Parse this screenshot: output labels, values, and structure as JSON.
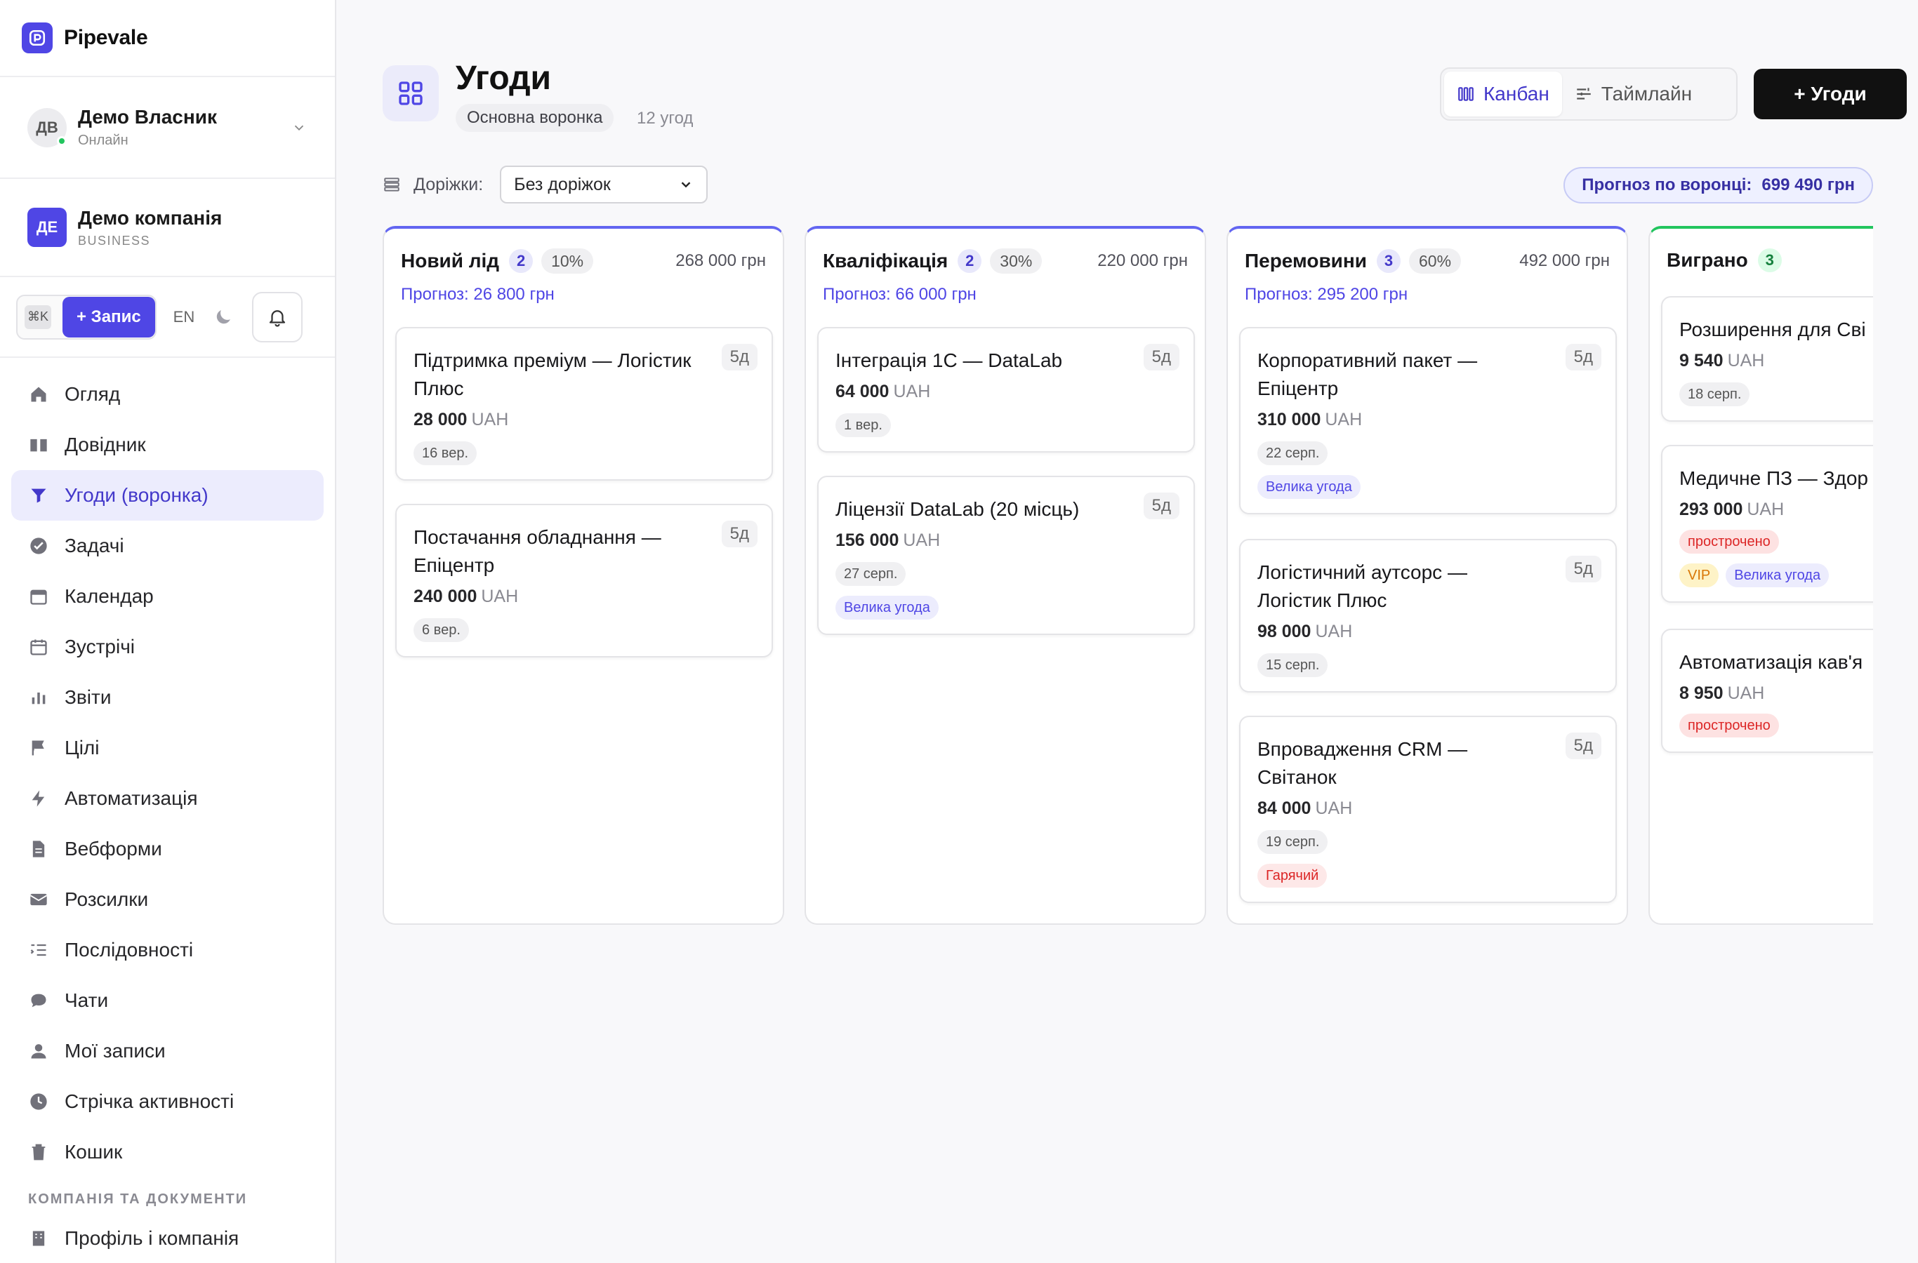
{
  "brand": {
    "name": "Pipevale"
  },
  "user": {
    "initials": "ДВ",
    "name": "Демо Власник",
    "status": "Онлайн"
  },
  "company": {
    "initials": "ДЕ",
    "name": "Демо компанія",
    "plan": "BUSINESS"
  },
  "actions": {
    "kbd": "⌘K",
    "record_label": "+ Запис",
    "lang": "EN"
  },
  "nav": {
    "items": [
      {
        "label": "Огляд",
        "icon": "home-icon"
      },
      {
        "label": "Довідник",
        "icon": "book-icon"
      },
      {
        "label": "Угоди (воронка)",
        "icon": "funnel-icon",
        "active": true
      },
      {
        "label": "Задачі",
        "icon": "check-circle-icon"
      },
      {
        "label": "Календар",
        "icon": "calendar-icon"
      },
      {
        "label": "Зустрічі",
        "icon": "calendar-outline-icon"
      },
      {
        "label": "Звіти",
        "icon": "bar-chart-icon"
      },
      {
        "label": "Цілі",
        "icon": "flag-icon"
      },
      {
        "label": "Автоматизація",
        "icon": "lightning-icon"
      },
      {
        "label": "Вебформи",
        "icon": "document-icon"
      },
      {
        "label": "Розсилки",
        "icon": "mail-icon"
      },
      {
        "label": "Послідовності",
        "icon": "list-icon"
      },
      {
        "label": "Чати",
        "icon": "chat-icon"
      },
      {
        "label": "Мої записи",
        "icon": "user-icon"
      },
      {
        "label": "Стрічка активності",
        "icon": "clock-icon"
      },
      {
        "label": "Кошик",
        "icon": "trash-icon"
      }
    ],
    "section_label": "КОМПАНІЯ ТА ДОКУМЕНТИ",
    "section_items": [
      {
        "label": "Профіль і компанія",
        "icon": "building-icon"
      }
    ]
  },
  "header": {
    "title": "Угоди",
    "funnel": "Основна воронка",
    "deal_count": "12 угод",
    "view_kanban": "Канбан",
    "view_timeline": "Таймлайн",
    "add_button": "+ Угоди"
  },
  "filters": {
    "lanes_label": "Доріжки:",
    "lanes_value": "Без доріжок",
    "forecast_label": "Прогноз по воронці:",
    "forecast_value": "699 490 грн"
  },
  "columns": [
    {
      "title": "Новий лід",
      "count": "2",
      "pct": "10%",
      "sum": "268 000 грн",
      "forecast": "Прогноз: 26 800 грн",
      "cards": [
        {
          "title": "Підтримка преміум — Логістик Плюс",
          "age": "5д",
          "amount": "28 000",
          "currency": "UAH",
          "date": "16 вер.",
          "tags": []
        },
        {
          "title": "Постачання обладнання — Епіцентр",
          "age": "5д",
          "amount": "240 000",
          "currency": "UAH",
          "date": "6 вер.",
          "tags": []
        }
      ]
    },
    {
      "title": "Кваліфікація",
      "count": "2",
      "pct": "30%",
      "sum": "220 000 грн",
      "forecast": "Прогноз: 66 000 грн",
      "cards": [
        {
          "title": "Інтеграція 1С — DataLab",
          "age": "5д",
          "amount": "64 000",
          "currency": "UAH",
          "date": "1 вер.",
          "tags": []
        },
        {
          "title": "Ліцензії DataLab (20 місць)",
          "age": "5д",
          "amount": "156 000",
          "currency": "UAH",
          "date": "27 серп.",
          "tags": [
            {
              "label": "Велика угода",
              "kind": "big"
            }
          ]
        }
      ]
    },
    {
      "title": "Перемовини",
      "count": "3",
      "pct": "60%",
      "sum": "492 000 грн",
      "forecast": "Прогноз: 295 200 грн",
      "cards": [
        {
          "title": "Корпоративний пакет — Епіцентр",
          "age": "5д",
          "amount": "310 000",
          "currency": "UAH",
          "date": "22 серп.",
          "tags": [
            {
              "label": "Велика угода",
              "kind": "big"
            }
          ]
        },
        {
          "title": "Логістичний аутсорс — Логістик Плюс",
          "age": "5д",
          "amount": "98 000",
          "currency": "UAH",
          "date": "15 серп.",
          "tags": []
        },
        {
          "title": "Впровадження CRM — Світанок",
          "age": "5д",
          "amount": "84 000",
          "currency": "UAH",
          "date": "19 серп.",
          "tags": [
            {
              "label": "Гарячий",
              "kind": "hot"
            }
          ]
        }
      ]
    },
    {
      "title": "Виграно",
      "count": "3",
      "pct": "",
      "sum": "",
      "forecast": "",
      "cards": [
        {
          "title": "Розширення для Сві",
          "age": "",
          "amount": "9 540",
          "currency": "UAH",
          "date": "18 серп.",
          "tags": []
        },
        {
          "title": "Медичне ПЗ — Здор",
          "age": "",
          "amount": "293 000",
          "currency": "UAH",
          "date": "",
          "tags": [
            {
              "label": "прострочено",
              "kind": "overdue"
            },
            {
              "label": "VIP",
              "kind": "vip"
            },
            {
              "label": "Велика угода",
              "kind": "big"
            }
          ]
        },
        {
          "title": "Автоматизація кав'я",
          "age": "",
          "amount": "8 950",
          "currency": "UAH",
          "date": "",
          "tags": [
            {
              "label": "прострочено",
              "kind": "overdue"
            }
          ]
        }
      ]
    }
  ],
  "colors": {
    "accent": "#4f46e5",
    "won": "#22c55e",
    "dark_button": "#111111"
  }
}
